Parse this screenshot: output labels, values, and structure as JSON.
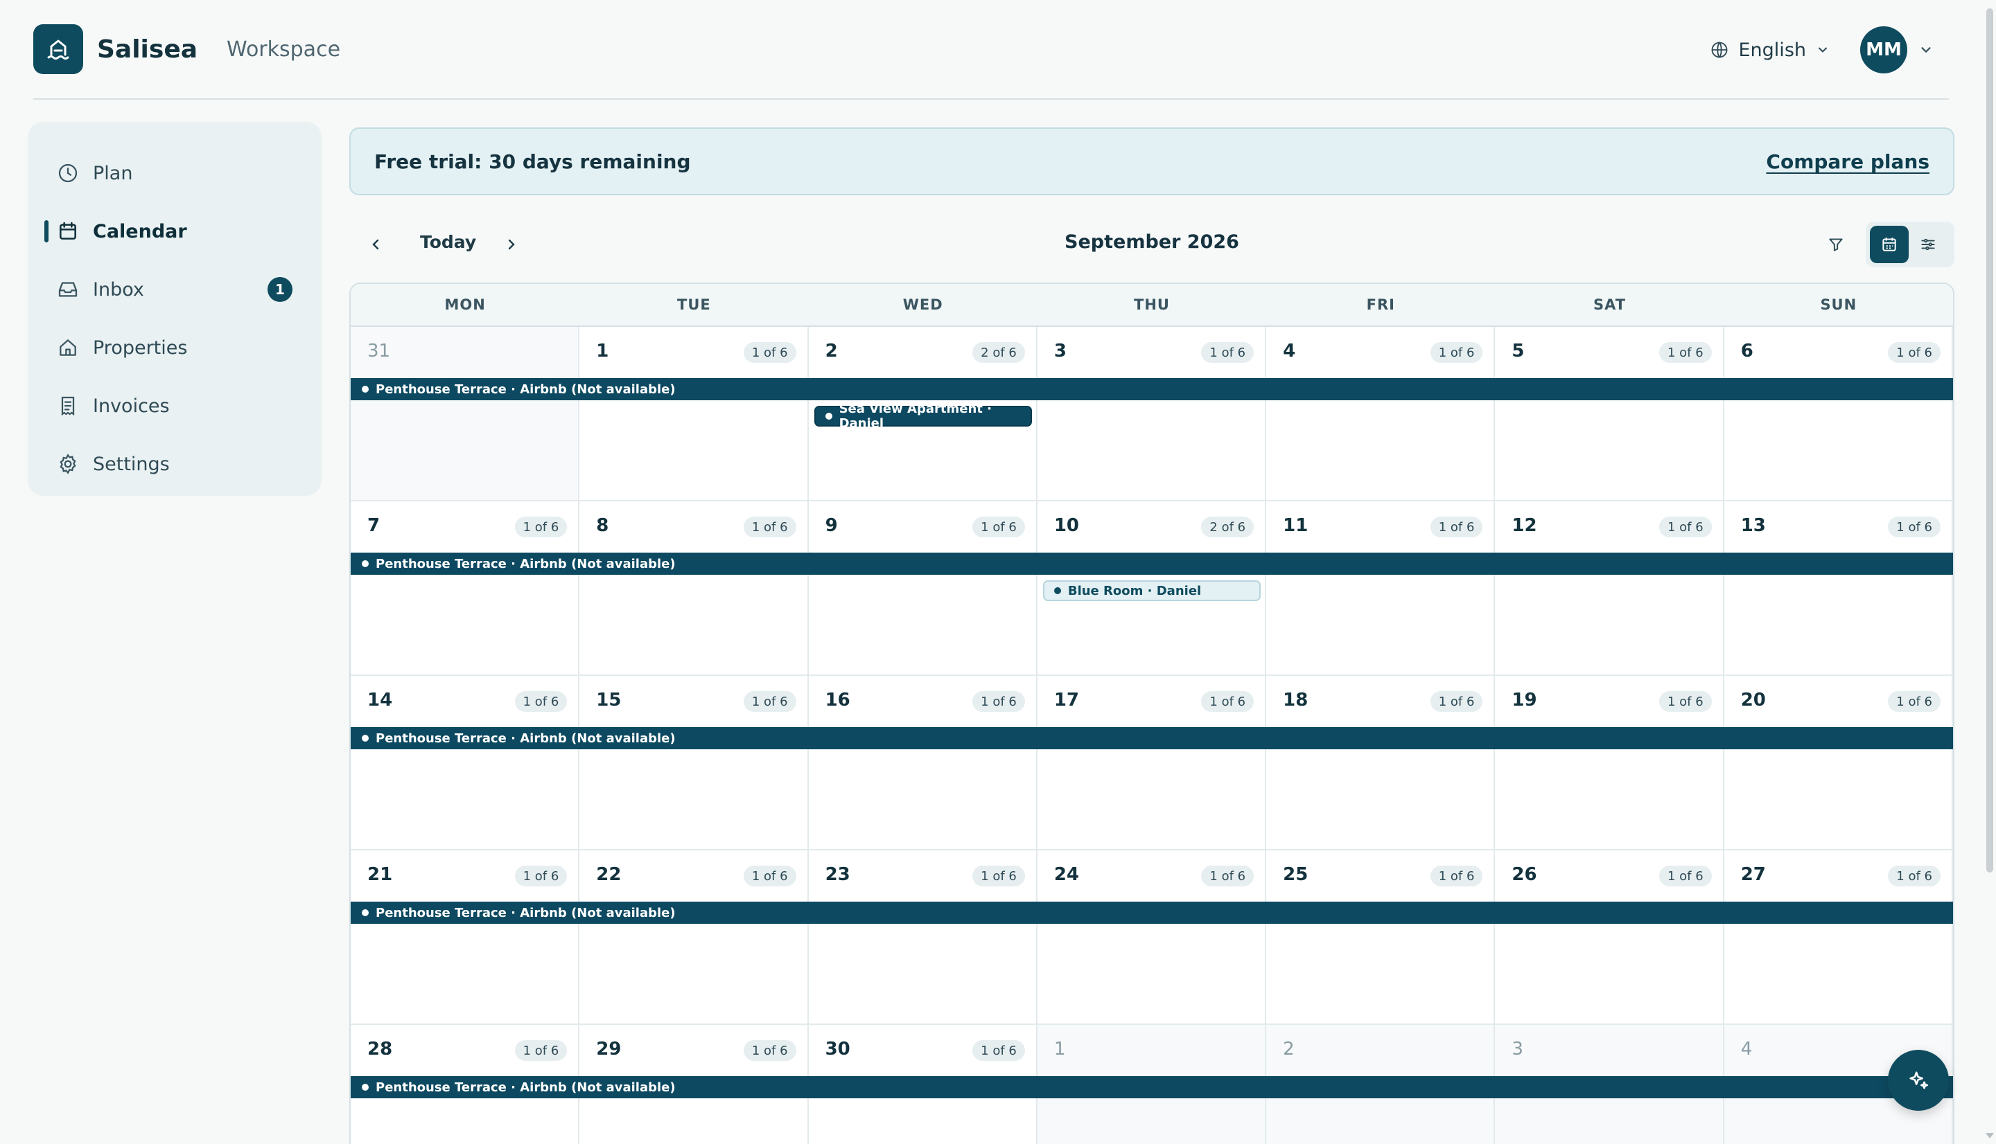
{
  "app": {
    "name": "Salisea",
    "workspace": "Workspace"
  },
  "header": {
    "language": "English",
    "user_initials": "MM"
  },
  "sidebar": {
    "items": [
      {
        "label": "Plan",
        "icon": "clock-icon"
      },
      {
        "label": "Calendar",
        "icon": "calendar-icon",
        "active": true
      },
      {
        "label": "Inbox",
        "icon": "inbox-icon",
        "badge": "1"
      },
      {
        "label": "Properties",
        "icon": "home-icon"
      },
      {
        "label": "Invoices",
        "icon": "receipt-icon"
      },
      {
        "label": "Settings",
        "icon": "gear-icon"
      }
    ]
  },
  "banner": {
    "text": "Free trial: 30 days remaining",
    "link": "Compare plans"
  },
  "toolbar": {
    "today": "Today",
    "month": "September 2026"
  },
  "calendar": {
    "weekdays": [
      "MON",
      "TUE",
      "WED",
      "THU",
      "FRI",
      "SAT",
      "SUN"
    ],
    "weeks": [
      {
        "days": [
          {
            "num": "31",
            "occ": "",
            "outside": true
          },
          {
            "num": "1",
            "occ": "1 of 6"
          },
          {
            "num": "2",
            "occ": "2 of 6"
          },
          {
            "num": "3",
            "occ": "1 of 6"
          },
          {
            "num": "4",
            "occ": "1 of 6"
          },
          {
            "num": "5",
            "occ": "1 of 6"
          },
          {
            "num": "6",
            "occ": "1 of 6"
          }
        ],
        "bar": "Penthouse Terrace · Airbnb (Not available)",
        "pill": {
          "text": "Sea View Apartment · Daniel",
          "style": "dark",
          "day": 2
        }
      },
      {
        "days": [
          {
            "num": "7",
            "occ": "1 of 6"
          },
          {
            "num": "8",
            "occ": "1 of 6"
          },
          {
            "num": "9",
            "occ": "1 of 6"
          },
          {
            "num": "10",
            "occ": "2 of 6"
          },
          {
            "num": "11",
            "occ": "1 of 6"
          },
          {
            "num": "12",
            "occ": "1 of 6"
          },
          {
            "num": "13",
            "occ": "1 of 6"
          }
        ],
        "bar": "Penthouse Terrace · Airbnb (Not available)",
        "pill": {
          "text": "Blue Room · Daniel",
          "style": "light",
          "day": 3
        }
      },
      {
        "days": [
          {
            "num": "14",
            "occ": "1 of 6"
          },
          {
            "num": "15",
            "occ": "1 of 6"
          },
          {
            "num": "16",
            "occ": "1 of 6"
          },
          {
            "num": "17",
            "occ": "1 of 6"
          },
          {
            "num": "18",
            "occ": "1 of 6"
          },
          {
            "num": "19",
            "occ": "1 of 6"
          },
          {
            "num": "20",
            "occ": "1 of 6"
          }
        ],
        "bar": "Penthouse Terrace · Airbnb (Not available)"
      },
      {
        "days": [
          {
            "num": "21",
            "occ": "1 of 6"
          },
          {
            "num": "22",
            "occ": "1 of 6"
          },
          {
            "num": "23",
            "occ": "1 of 6"
          },
          {
            "num": "24",
            "occ": "1 of 6"
          },
          {
            "num": "25",
            "occ": "1 of 6"
          },
          {
            "num": "26",
            "occ": "1 of 6"
          },
          {
            "num": "27",
            "occ": "1 of 6"
          }
        ],
        "bar": "Penthouse Terrace · Airbnb (Not available)"
      },
      {
        "days": [
          {
            "num": "28",
            "occ": "1 of 6"
          },
          {
            "num": "29",
            "occ": "1 of 6"
          },
          {
            "num": "30",
            "occ": "1 of 6"
          },
          {
            "num": "1",
            "occ": "",
            "outside": true
          },
          {
            "num": "2",
            "occ": "",
            "outside": true
          },
          {
            "num": "3",
            "occ": "",
            "outside": true
          },
          {
            "num": "4",
            "occ": "",
            "outside": true
          }
        ],
        "bar": "Penthouse Terrace · Airbnb (Not available)"
      }
    ]
  },
  "colors": {
    "brand": "#0f4b5e",
    "event_bar": "#0d4961",
    "banner_bg": "#e4f1f4"
  }
}
